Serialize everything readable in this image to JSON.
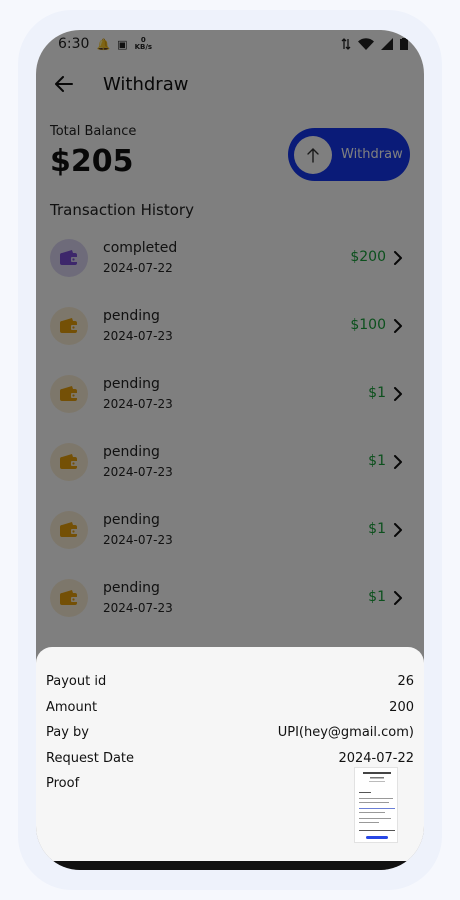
{
  "status_bar": {
    "time": "6:30",
    "speed_value": "0",
    "speed_unit": "KB/s"
  },
  "header": {
    "title": "Withdraw"
  },
  "balance": {
    "label": "Total Balance",
    "value": "$205",
    "withdraw_label": "Withdraw"
  },
  "history": {
    "title": "Transaction History",
    "items": [
      {
        "status": "completed",
        "date": "2024-07-22",
        "amount": "$200",
        "icon": "wallet-icon"
      },
      {
        "status": "pending",
        "date": "2024-07-23",
        "amount": "$100",
        "icon": "wallet-icon"
      },
      {
        "status": "pending",
        "date": "2024-07-23",
        "amount": "$1",
        "icon": "wallet-icon"
      },
      {
        "status": "pending",
        "date": "2024-07-23",
        "amount": "$1",
        "icon": "wallet-icon"
      },
      {
        "status": "pending",
        "date": "2024-07-23",
        "amount": "$1",
        "icon": "wallet-icon"
      },
      {
        "status": "pending",
        "date": "2024-07-23",
        "amount": "$1",
        "icon": "wallet-icon"
      }
    ]
  },
  "detail_sheet": {
    "payout_id_label": "Payout id",
    "payout_id_value": "26",
    "amount_label": "Amount",
    "amount_value": "200",
    "pay_by_label": "Pay by",
    "pay_by_value": "UPI(hey@gmail.com)",
    "request_date_label": "Request Date",
    "request_date_value": "2024-07-22",
    "proof_label": "Proof"
  },
  "colors": {
    "accent": "#1537f0",
    "amount": "#19a03a",
    "completed_icon": "#7a4fd6",
    "pending_icon": "#e8a10c",
    "overlay": "#000000"
  }
}
